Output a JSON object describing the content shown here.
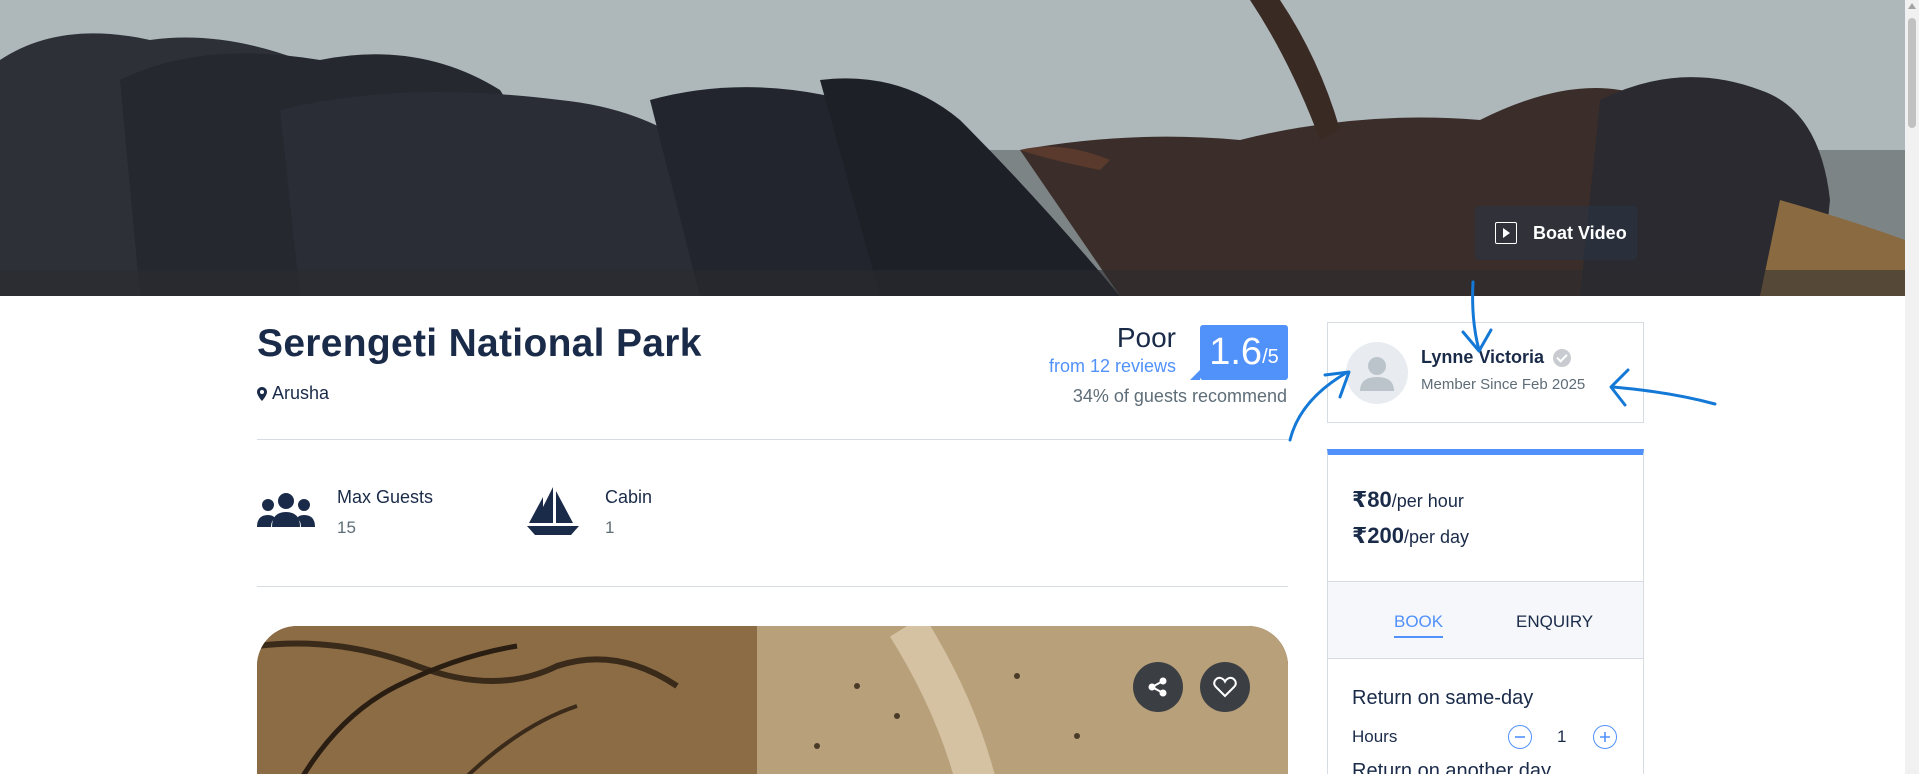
{
  "hero": {
    "video_button_label": "Boat Video"
  },
  "listing": {
    "title": "Serengeti National Park",
    "location": "Arusha"
  },
  "rating": {
    "word": "Poor",
    "reviews": "from 12 reviews",
    "recommend": "34% of guests recommend",
    "score": "1.6",
    "scale": "/5"
  },
  "facts": [
    {
      "label": "Max Guests",
      "value": "15",
      "icon": "guests-icon"
    },
    {
      "label": "Cabin",
      "value": "1",
      "icon": "sailboat-icon"
    }
  ],
  "owner": {
    "name": "Lynne Victoria",
    "since": "Member Since Feb 2025",
    "icon": "avatar-placeholder-icon"
  },
  "booking": {
    "price_hour": "₹80",
    "price_hour_unit": "/per hour",
    "price_day": "₹200",
    "price_day_unit": "/per day",
    "tabs": [
      "BOOK",
      "ENQUIRY"
    ],
    "active_tab": "BOOK",
    "option_same_day": "Return on same-day",
    "hours_label": "Hours",
    "hours_value": "1",
    "option_another_day": "Return on another day"
  },
  "colors": {
    "accent": "#5191fa",
    "text": "#1a2b49",
    "muted": "#5e6d77",
    "annotation": "#1479d6"
  }
}
